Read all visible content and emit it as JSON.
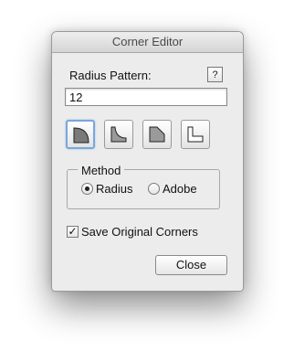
{
  "window": {
    "title": "Corner Editor"
  },
  "radius": {
    "label": "Radius Pattern:",
    "help_label": "?",
    "value": "12"
  },
  "shapes": [
    {
      "name": "rounded",
      "selected": true
    },
    {
      "name": "inverse-rounded",
      "selected": false
    },
    {
      "name": "chamfer",
      "selected": false
    },
    {
      "name": "inset",
      "selected": false
    }
  ],
  "method": {
    "title": "Method",
    "options": [
      {
        "label": "Radius",
        "selected": true
      },
      {
        "label": "Adobe",
        "selected": false
      }
    ]
  },
  "save_original": {
    "label": "Save Original Corners",
    "checked": true,
    "check_mark": "✓"
  },
  "close_button": {
    "label": "Close"
  }
}
